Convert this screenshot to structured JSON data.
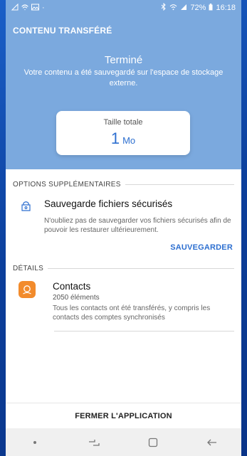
{
  "status_bar": {
    "battery_percent": "72%",
    "time": "16:18"
  },
  "header": {
    "title": "CONTENU TRANSFÉRÉ"
  },
  "hero": {
    "status_title": "Terminé",
    "status_message": "Votre contenu a été sauvegardé sur l'espace de stockage externe."
  },
  "size_card": {
    "label": "Taille totale",
    "value": "1",
    "unit": "Mo"
  },
  "options_section": {
    "header": "OPTIONS SUPPLÉMENTAIRES",
    "item_title": "Sauvegarde fichiers sécurisés",
    "item_desc": "N'oubliez pas de sauvegarder vos fichiers sécurisés afin de pouvoir les restaurer ultérieurement.",
    "action_label": "SAUVEGARDER"
  },
  "details_section": {
    "header": "DÉTAILS",
    "item_title": "Contacts",
    "item_count": "2050 éléments",
    "item_desc": "Tous les contacts ont été transférés, y compris les contacts des comptes synchronisés"
  },
  "footer": {
    "close_label": "FERMER L'APPLICATION"
  },
  "colors": {
    "header_bg": "#7ba9de",
    "accent": "#2d6fd0",
    "contact_icon": "#f28b2c"
  }
}
